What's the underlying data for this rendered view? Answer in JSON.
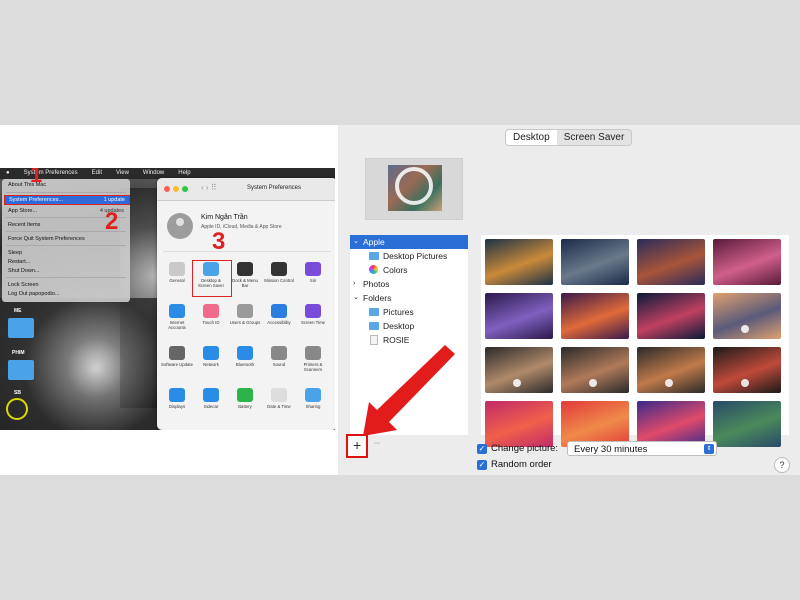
{
  "left_screenshot": {
    "menubar": {
      "items": [
        "System Preferences",
        "Edit",
        "View",
        "Window",
        "Help"
      ]
    },
    "apple_menu": {
      "items": [
        {
          "label": "About This Mac"
        },
        {
          "label": "System Preferences...",
          "badge": "1 update"
        },
        {
          "label": "App Store...",
          "badge": "4 updates"
        },
        {
          "label": "Recent Items"
        },
        {
          "label": "Force Quit System Preferences"
        },
        {
          "label": "Sleep"
        },
        {
          "label": "Restart..."
        },
        {
          "label": "Shut Down..."
        },
        {
          "label": "Lock Screen"
        },
        {
          "label": "Log Out papopodio..."
        }
      ]
    },
    "step_numbers": [
      "1",
      "2",
      "3"
    ],
    "desktop_folders": [
      "ME",
      "PHIM",
      "SB"
    ],
    "system_preferences": {
      "title": "System Preferences",
      "user_name": "Kim Ngân Trần",
      "user_sub": "Apple ID, iCloud, Media & App Store",
      "panes": [
        {
          "label": "General",
          "icon": "general-icon",
          "color": "#c9c9c9"
        },
        {
          "label": "Desktop & Screen Saver",
          "icon": "desktop-icon",
          "color": "#4aa3e8"
        },
        {
          "label": "Dock & Menu Bar",
          "icon": "dock-icon",
          "color": "#333333"
        },
        {
          "label": "Mission Control",
          "icon": "mission-control-icon",
          "color": "#333333"
        },
        {
          "label": "Siri",
          "icon": "siri-icon",
          "color": "#7a4ad8"
        },
        {
          "label": "Internet Accounts",
          "icon": "at-icon",
          "color": "#2b8ce8"
        },
        {
          "label": "Touch ID",
          "icon": "fingerprint-icon",
          "color": "#f06a8a"
        },
        {
          "label": "Users & Groups",
          "icon": "users-icon",
          "color": "#9a9a9a"
        },
        {
          "label": "Accessibility",
          "icon": "accessibility-icon",
          "color": "#2b7de0"
        },
        {
          "label": "Screen Time",
          "icon": "hourglass-icon",
          "color": "#7a4ad8"
        },
        {
          "label": "Software Update",
          "icon": "gear-icon",
          "color": "#666666"
        },
        {
          "label": "Network",
          "icon": "globe-icon",
          "color": "#2b8ce8"
        },
        {
          "label": "Bluetooth",
          "icon": "bluetooth-icon",
          "color": "#2b8ce8"
        },
        {
          "label": "Sound",
          "icon": "speaker-icon",
          "color": "#888888"
        },
        {
          "label": "Printers & Scanners",
          "icon": "printer-icon",
          "color": "#888888"
        },
        {
          "label": "Displays",
          "icon": "display-icon",
          "color": "#2b8ce8"
        },
        {
          "label": "Sidecar",
          "icon": "sidecar-icon",
          "color": "#2b8ce8"
        },
        {
          "label": "Battery",
          "icon": "battery-icon",
          "color": "#2db34a"
        },
        {
          "label": "Date & Time",
          "icon": "clock-icon",
          "color": "#dddddd"
        },
        {
          "label": "Sharing",
          "icon": "folder-icon",
          "color": "#4aa3e8"
        }
      ]
    }
  },
  "desktop_pref": {
    "tabs": {
      "desktop": "Desktop",
      "screen_saver": "Screen Saver"
    },
    "sidebar": {
      "apple": "Apple",
      "desktop_pictures": "Desktop Pictures",
      "colors": "Colors",
      "photos": "Photos",
      "folders": "Folders",
      "pictures": "Pictures",
      "desktop": "Desktop",
      "rosie": "ROSIE"
    },
    "add_button": "+",
    "remove_button": "−",
    "change_picture_label": "Change picture:",
    "change_picture_value": "Every 30 minutes",
    "random_order_label": "Random order",
    "help": "?",
    "wallpapers": [
      {
        "c1": "#1c3146",
        "c2": "#c98a3a",
        "dynamic": false
      },
      {
        "c1": "#1a2a4a",
        "c2": "#6a7a8a",
        "dynamic": false
      },
      {
        "c1": "#2a2a5a",
        "c2": "#a8553a",
        "dynamic": false
      },
      {
        "c1": "#5a1a3a",
        "c2": "#d0608a",
        "dynamic": false
      },
      {
        "c1": "#2a1a4a",
        "c2": "#8060c0",
        "dynamic": false
      },
      {
        "c1": "#3a1a4a",
        "c2": "#e06a3a",
        "dynamic": false
      },
      {
        "c1": "#0a1a3a",
        "c2": "#c04060",
        "dynamic": false
      },
      {
        "c1": "#e0a070",
        "c2": "#5a5a7a",
        "dynamic": true
      },
      {
        "c1": "#2a2a2a",
        "c2": "#b08a6a",
        "dynamic": true
      },
      {
        "c1": "#2a2a2a",
        "c2": "#b07a5a",
        "dynamic": true
      },
      {
        "c1": "#2a2a2a",
        "c2": "#c07a4a",
        "dynamic": true
      },
      {
        "c1": "#1a1a1a",
        "c2": "#c04a3a",
        "dynamic": true
      },
      {
        "c1": "#c02a6a",
        "c2": "#f0604a",
        "dynamic": false
      },
      {
        "c1": "#e03a3a",
        "c2": "#f08a4a",
        "dynamic": false
      },
      {
        "c1": "#3a2a8a",
        "c2": "#e04a6a",
        "dynamic": false
      },
      {
        "c1": "#2a4a6a",
        "c2": "#4a8a5a",
        "dynamic": false
      }
    ]
  }
}
